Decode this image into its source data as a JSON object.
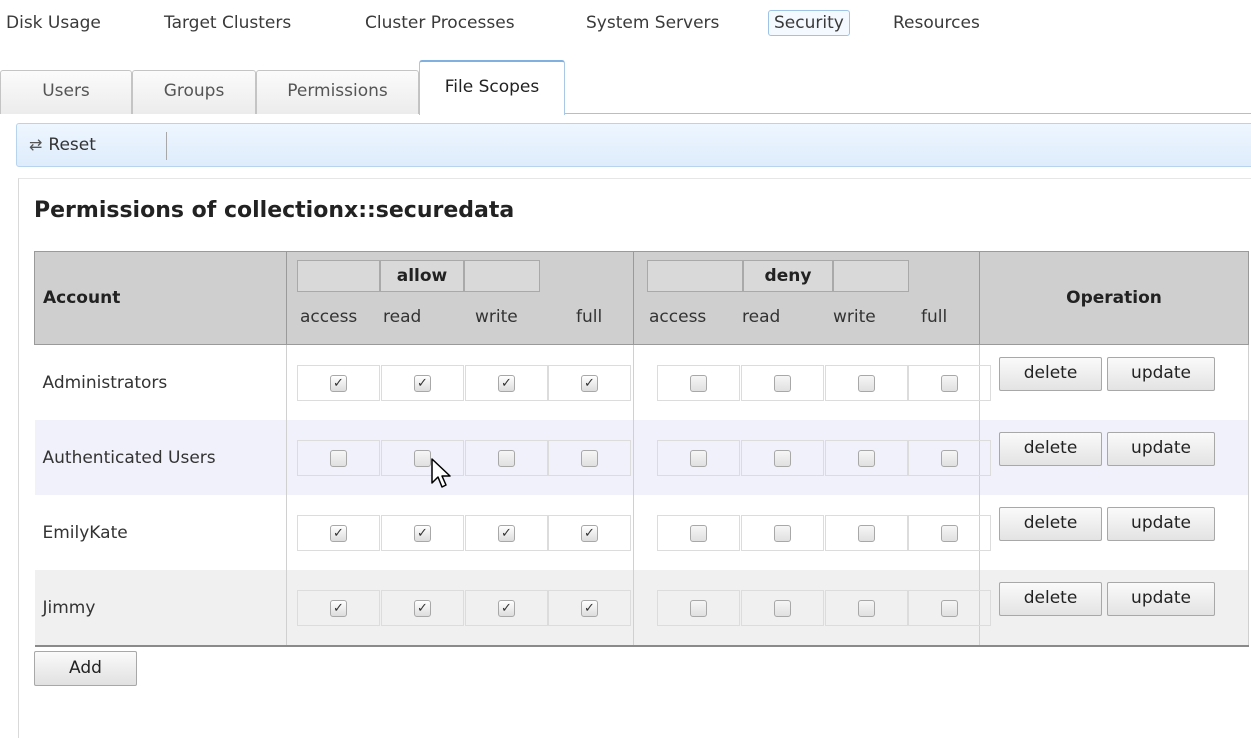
{
  "topnav": {
    "items": [
      "Disk Usage",
      "Target Clusters",
      "Cluster Processes",
      "System Servers",
      "Security",
      "Resources"
    ],
    "active": "Security"
  },
  "subtabs": {
    "items": [
      "Users",
      "Groups",
      "Permissions",
      "File Scopes"
    ],
    "active": "File Scopes"
  },
  "toolbar": {
    "reset_label": "Reset",
    "reset_icon": "refresh-icon"
  },
  "page_title": "Permissions of collectionx::securedata",
  "table": {
    "account_header": "Account",
    "allow_header": "allow",
    "deny_header": "deny",
    "operation_header": "Operation",
    "permission_labels": [
      "access",
      "read",
      "write",
      "full"
    ],
    "rows": [
      {
        "account": "Administrators",
        "allow": [
          true,
          true,
          true,
          true
        ],
        "deny": [
          false,
          false,
          false,
          false
        ]
      },
      {
        "account": "Authenticated Users",
        "allow": [
          false,
          false,
          false,
          false
        ],
        "deny": [
          false,
          false,
          false,
          false
        ]
      },
      {
        "account": "EmilyKate",
        "allow": [
          true,
          true,
          true,
          true
        ],
        "deny": [
          false,
          false,
          false,
          false
        ]
      },
      {
        "account": "Jimmy",
        "allow": [
          true,
          true,
          true,
          true
        ],
        "deny": [
          false,
          false,
          false,
          false
        ]
      }
    ],
    "delete_label": "delete",
    "update_label": "update"
  },
  "add_label": "Add",
  "colors": {
    "header_bg": "#cfcfcf",
    "toolbar_bg": "#e6f1fd",
    "alt_row": "#f1f1fb"
  }
}
